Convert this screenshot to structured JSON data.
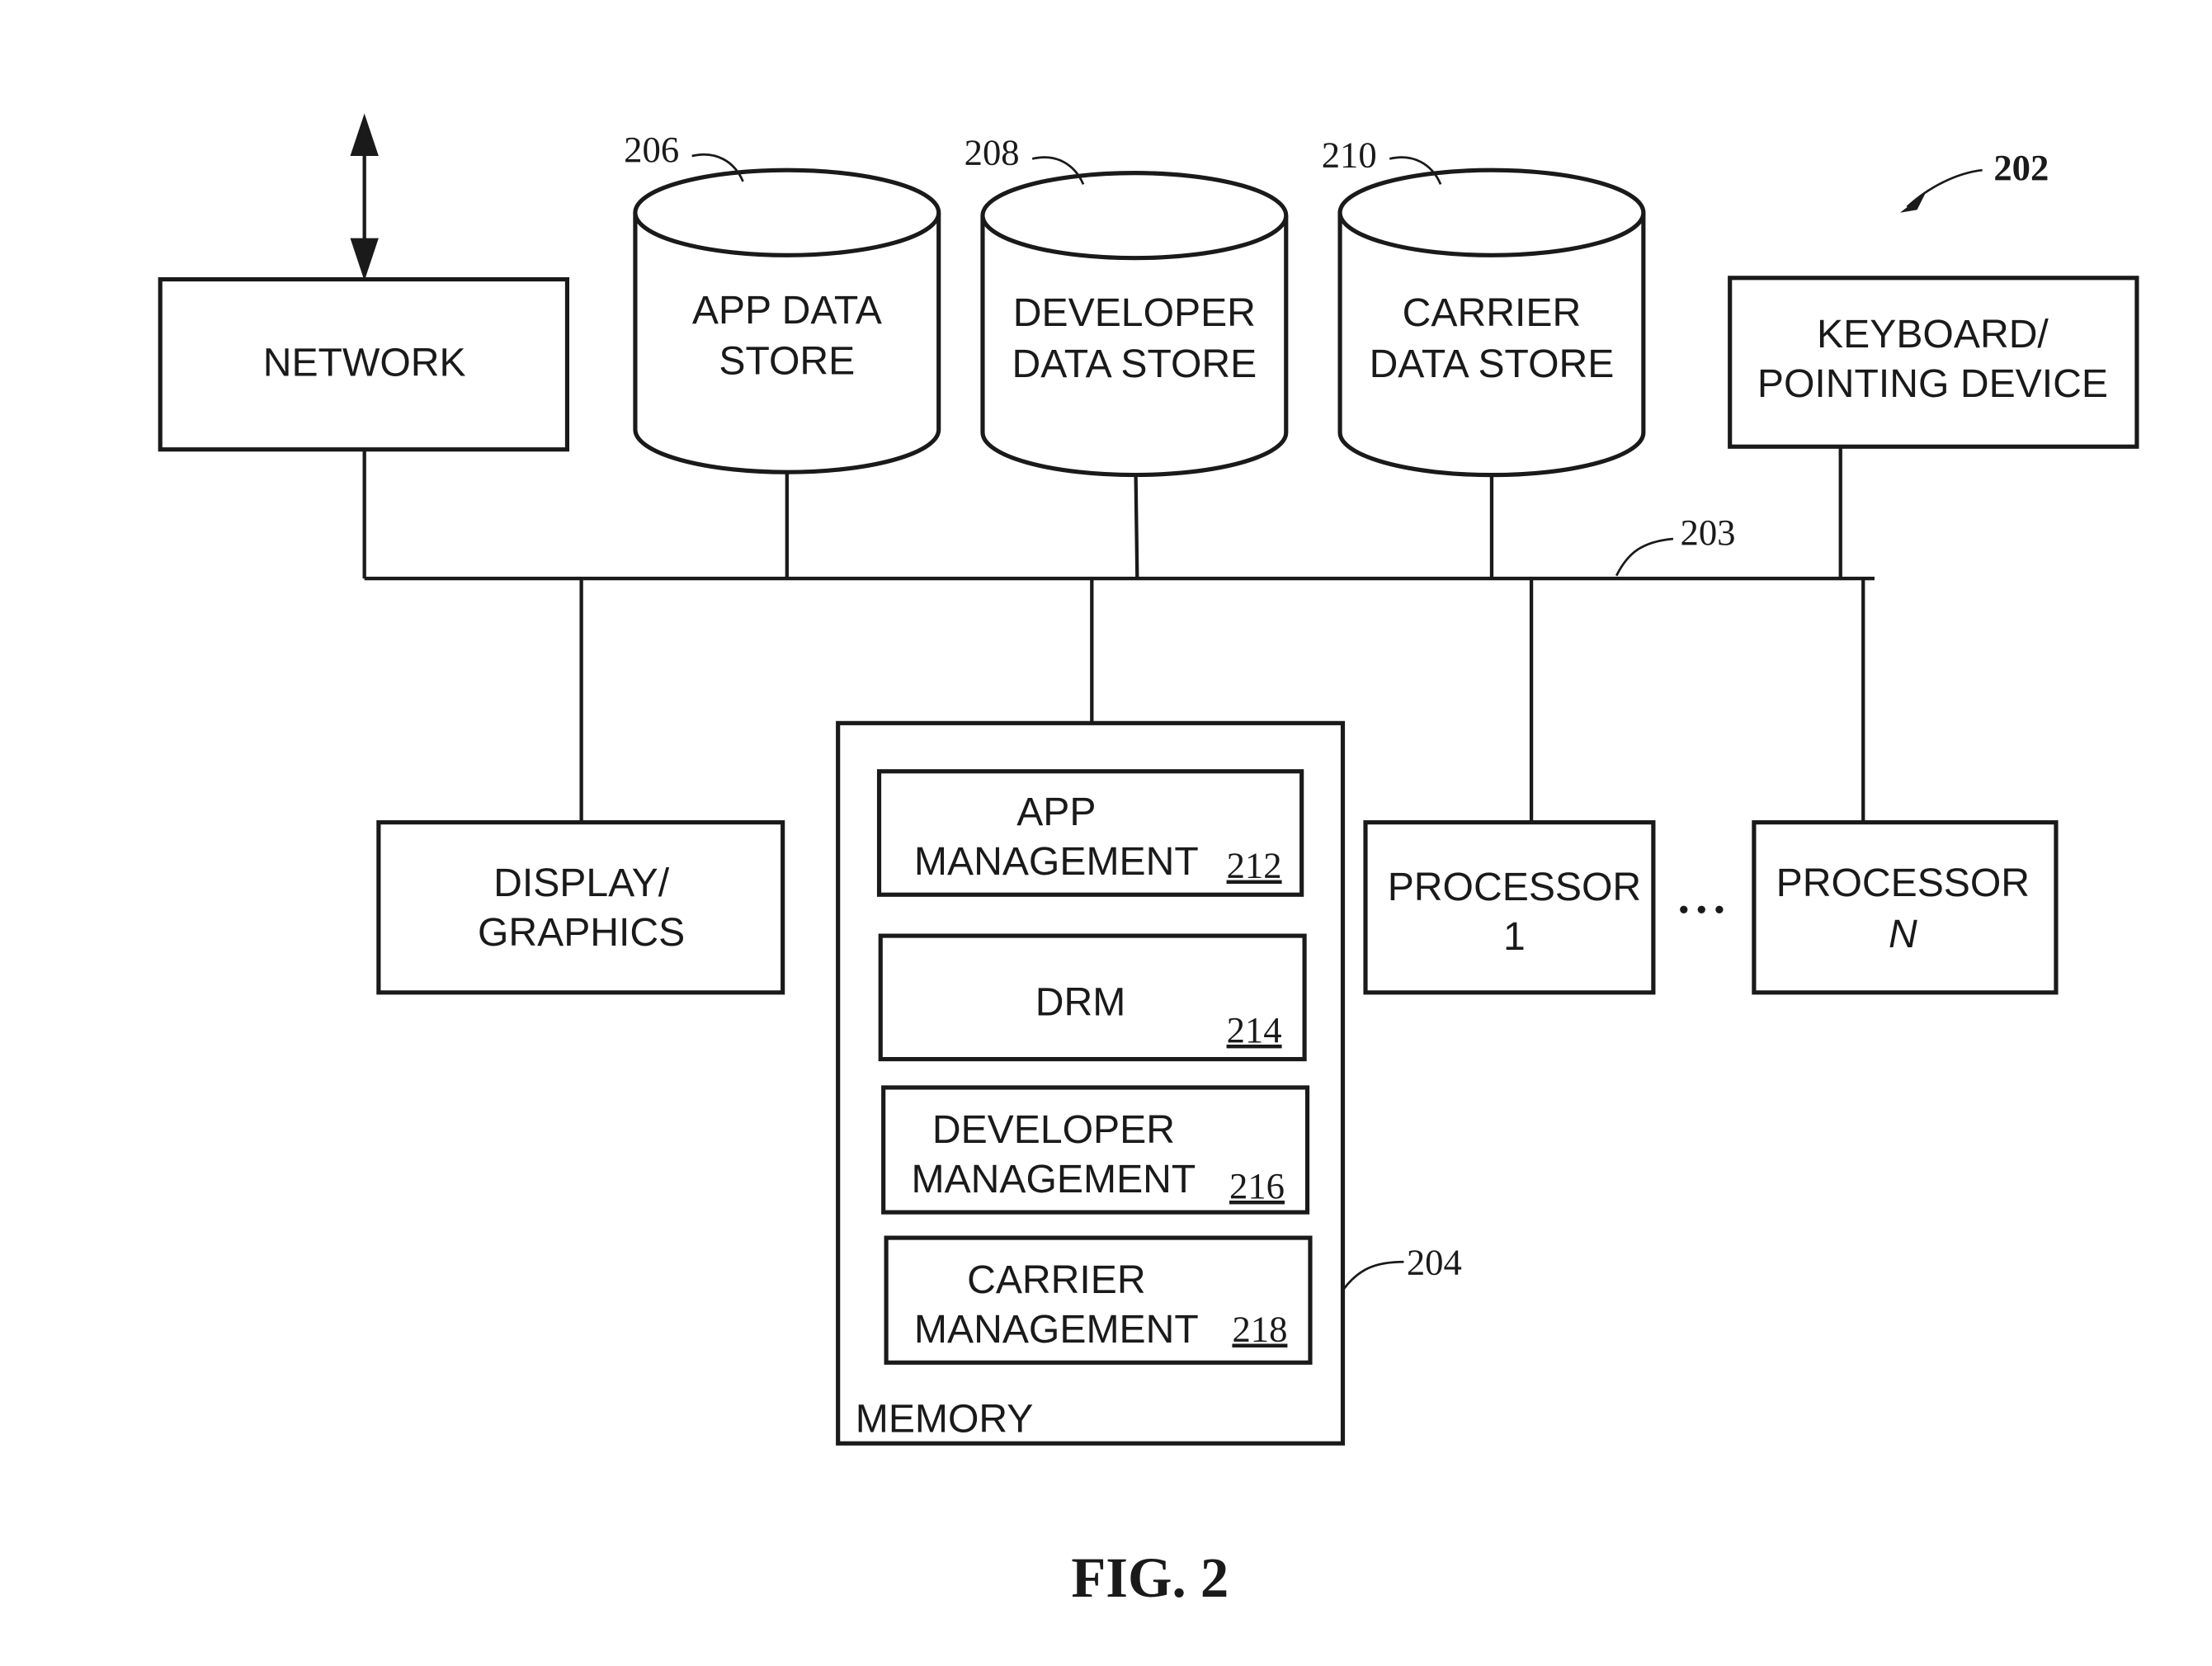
{
  "figure": {
    "caption": "FIG. 2",
    "system_ref": "202",
    "bus_ref": "203"
  },
  "network": {
    "label": "NETWORK"
  },
  "data_stores": [
    {
      "ref": "206",
      "line1": "APP DATA",
      "line2": "STORE"
    },
    {
      "ref": "208",
      "line1": "DEVELOPER",
      "line2": "DATA STORE"
    },
    {
      "ref": "210",
      "line1": "CARRIER",
      "line2": "DATA STORE"
    }
  ],
  "keyboard": {
    "line1": "KEYBOARD/",
    "line2": "POINTING DEVICE"
  },
  "display": {
    "line1": "DISPLAY/",
    "line2": "GRAPHICS"
  },
  "memory": {
    "label": "MEMORY",
    "ref": "204",
    "modules": [
      {
        "line1": "APP",
        "line2": "MANAGEMENT",
        "ref": "212"
      },
      {
        "line1": "DRM",
        "line2": "",
        "ref": "214"
      },
      {
        "line1": "DEVELOPER",
        "line2": "MANAGEMENT",
        "ref": "216"
      },
      {
        "line1": "CARRIER",
        "line2": "MANAGEMENT",
        "ref": "218"
      }
    ]
  },
  "processors": [
    {
      "line1": "PROCESSOR",
      "line2": "1"
    },
    {
      "line1": "PROCESSOR",
      "line2": "N"
    }
  ],
  "ellipsis": "• • •"
}
